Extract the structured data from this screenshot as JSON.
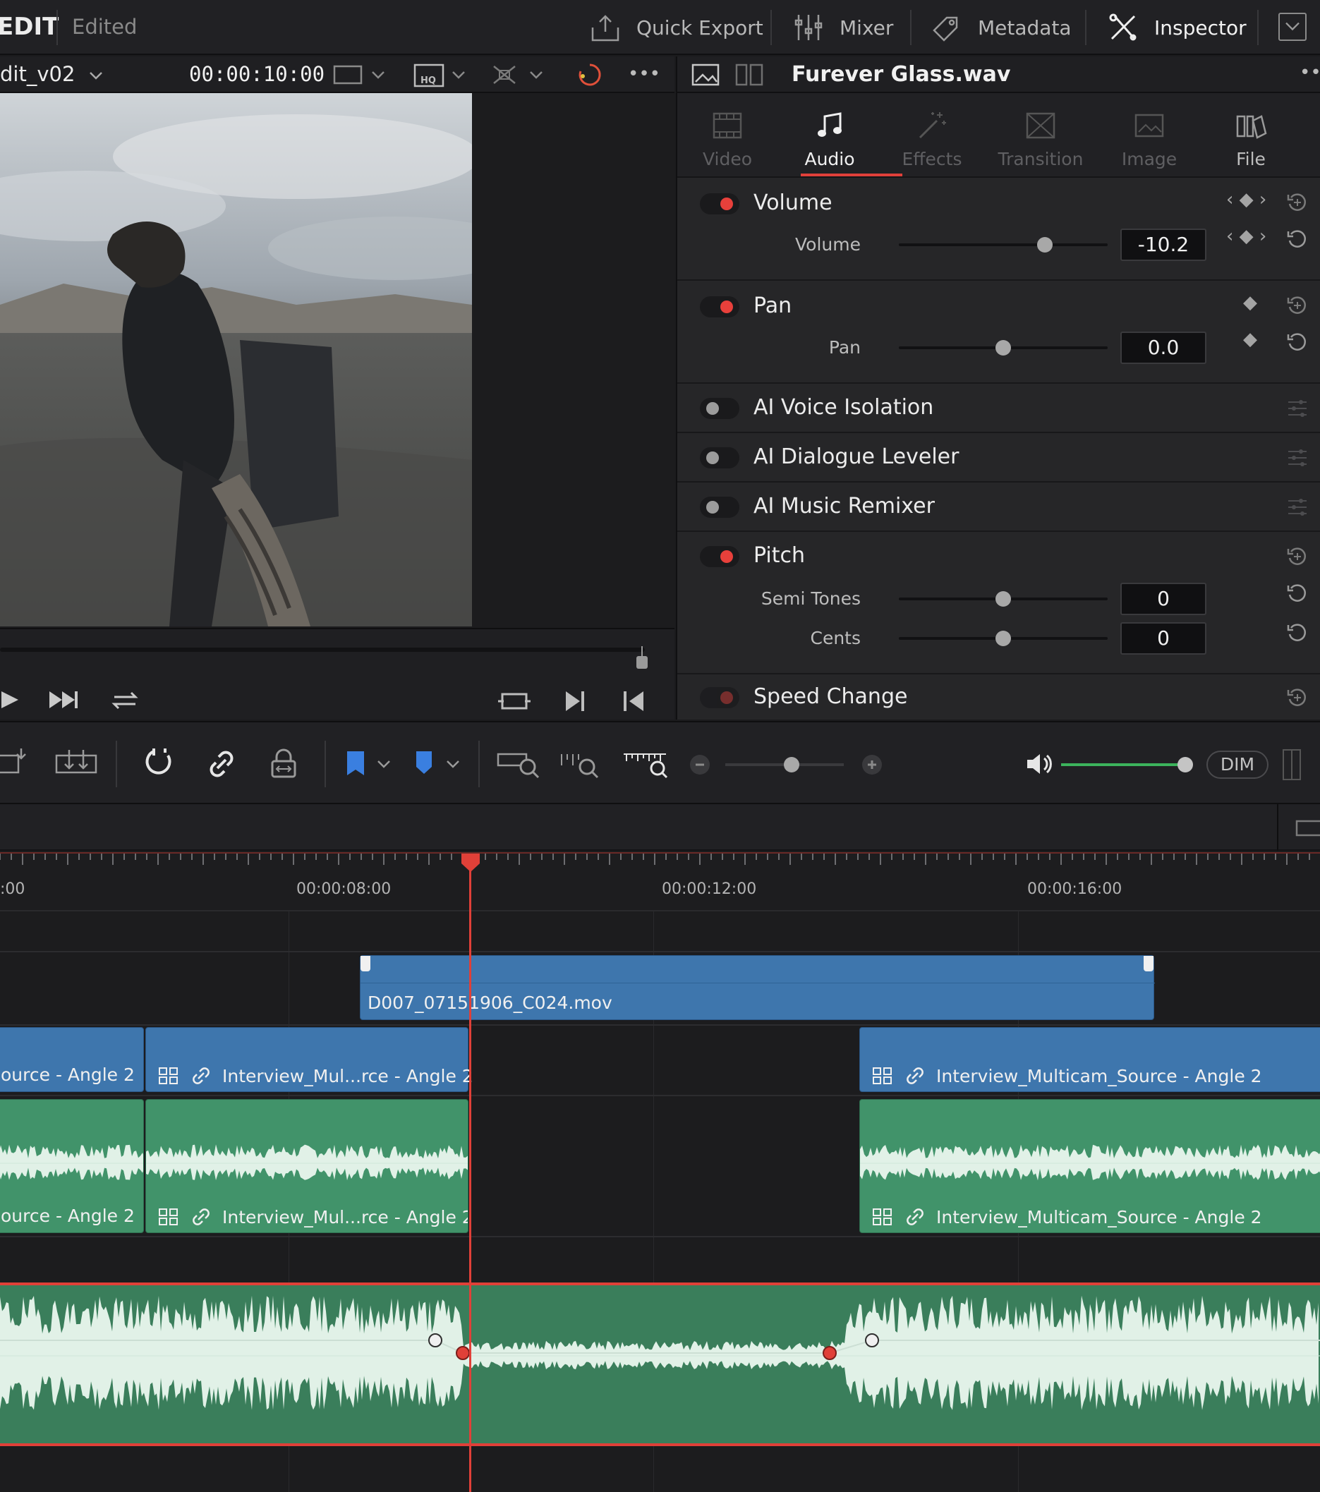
{
  "app": {
    "mode": "EDIT",
    "status": "Edited"
  },
  "topbar": {
    "quick_export": "Quick Export",
    "mixer": "Mixer",
    "metadata": "Metadata",
    "inspector": "Inspector"
  },
  "viewer": {
    "timeline_name": "dit_v02",
    "timecode": "00:00:10:00"
  },
  "inspector": {
    "clip_name": "Furever Glass.wav",
    "tabs": [
      {
        "label": "Video",
        "icon": "video-icon",
        "active": false
      },
      {
        "label": "Audio",
        "icon": "music-note-icon",
        "active": true
      },
      {
        "label": "Effects",
        "icon": "magic-wand-icon",
        "active": false
      },
      {
        "label": "Transition",
        "icon": "transition-icon",
        "active": false
      },
      {
        "label": "Image",
        "icon": "image-icon",
        "active": false
      },
      {
        "label": "File",
        "icon": "file-icon",
        "active": false
      }
    ],
    "volume": {
      "title": "Volume",
      "param_label": "Volume",
      "value": "-10.2",
      "level": 0.7,
      "enabled": true
    },
    "pan": {
      "title": "Pan",
      "param_label": "Pan",
      "value": "0.0",
      "level": 0.5,
      "enabled": true
    },
    "ai_voice_isolation": {
      "title": "AI Voice Isolation",
      "enabled": false
    },
    "ai_dialogue_leveler": {
      "title": "AI Dialogue Leveler",
      "enabled": false
    },
    "ai_music_remixer": {
      "title": "AI Music Remixer",
      "enabled": false
    },
    "pitch": {
      "title": "Pitch",
      "enabled": true,
      "semi_tones_label": "Semi Tones",
      "semi_tones_value": "0",
      "semi_tones_level": 0.5,
      "cents_label": "Cents",
      "cents_value": "0",
      "cents_level": 0.5
    },
    "speed_change": {
      "title": "Speed Change",
      "enabled": true
    }
  },
  "toolbar": {
    "dim_label": "DIM",
    "zoom_level": 0.56,
    "monitor_volume_level": 1.0
  },
  "timeline": {
    "ruler": {
      "ticks": [
        ":00",
        "00:00:08:00",
        "00:00:12:00",
        "00:00:16:00"
      ]
    },
    "video_clips": [
      {
        "name": "D007_07151906_C024.mov"
      }
    ],
    "v1_clips": [
      {
        "name": "ource - Angle 2"
      },
      {
        "name": "Interview_Mul...rce - Angle 2"
      },
      {
        "name": "Interview_Multicam_Source - Angle 2"
      }
    ],
    "a1_clips": [
      {
        "name": "ource - Angle 2"
      },
      {
        "name": "Interview_Mul...rce - Angle 2"
      },
      {
        "name": "Interview_Multicam_Source - Angle 2"
      }
    ],
    "colors": {
      "video_clip": "#3e76ad",
      "audio_clip": "#41936a",
      "playhead": "#e04038",
      "toggle_on": "#e8403b"
    }
  }
}
